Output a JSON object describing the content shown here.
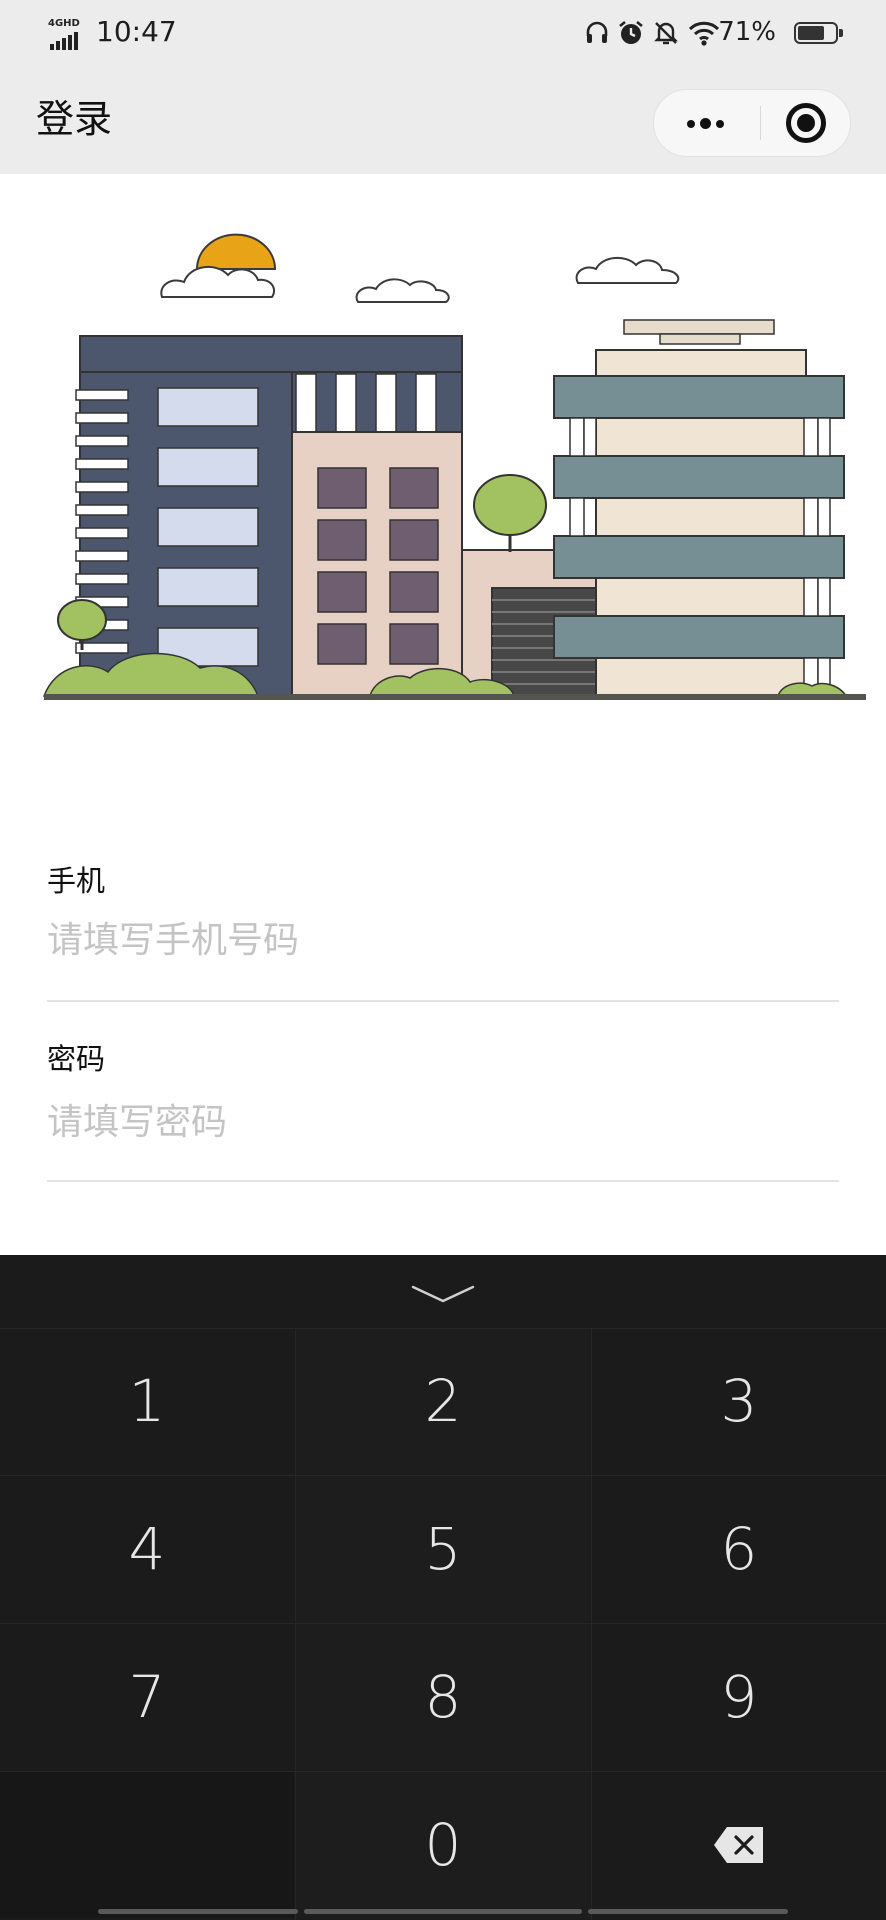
{
  "status_bar": {
    "network": "4GHD",
    "time": "10:47",
    "battery_percent": "71%",
    "battery_level": 0.71,
    "icons": [
      "headphones-icon",
      "alarm-icon",
      "bell-muted-icon",
      "wifi-icon",
      "battery-icon"
    ]
  },
  "nav": {
    "title": "登录",
    "more_icon": "more-dots-icon",
    "close_icon": "target-close-icon"
  },
  "form": {
    "phone": {
      "label": "手机",
      "placeholder": "请填写手机号码",
      "value": ""
    },
    "password": {
      "label": "密码",
      "placeholder": "请填写密码",
      "value": ""
    }
  },
  "keyboard": {
    "hide_icon": "chevron-down-icon",
    "keys": [
      "1",
      "2",
      "3",
      "4",
      "5",
      "6",
      "7",
      "8",
      "9",
      "",
      "0",
      "backspace"
    ],
    "backspace_icon": "backspace-icon"
  },
  "colors": {
    "nav_bg": "#ececec",
    "keyboard_bg": "#1b1b1b",
    "key_text": "#e6e6e6",
    "placeholder": "#c4c4c4"
  }
}
